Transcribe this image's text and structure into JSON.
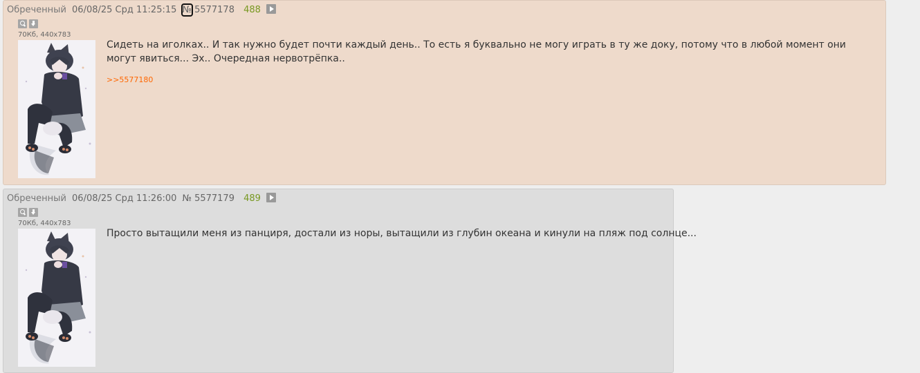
{
  "posts": [
    {
      "name": "Обреченный",
      "date": "06/08/25 Срд 11:25:15",
      "number_prefix": "№",
      "number": "5577178",
      "count": "488",
      "file_info": "70Кб, 440x783",
      "body": "Сидеть на иголках.. И так нужно будет почти каждый день.. То есть я буквально не могу играть в ту же доку, потому что в любой момент они могут явиться... Эх.. Очередная нервотрёпка..",
      "reply_link": ">>5577180"
    },
    {
      "name": "Обреченный",
      "date": "06/08/25 Срд 11:26:00",
      "number_prefix": "№",
      "number": "5577179",
      "count": "489",
      "file_info": "70Кб, 440x783",
      "body": "Просто вытащили меня из панциря, достали из норы, вытащили из глубин океана и кинули на пляж под солнце..."
    }
  ],
  "colors": {
    "post1_bg": "#eedacb",
    "post2_bg": "#dddddd",
    "reply_link": "#ff6600",
    "count": "#789922",
    "page_bg": "#eeeeee"
  },
  "icons": {
    "expand": "play-icon",
    "zoom": "search-icon",
    "download": "download-icon"
  }
}
